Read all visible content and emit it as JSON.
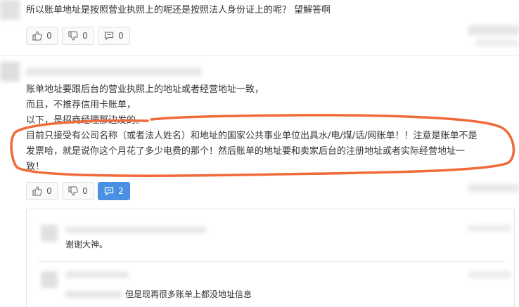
{
  "comment1": {
    "text": "所以账单地址是按照营业执照上的呢还是按照法人身份证上的呢？ 望解答啊",
    "likes": "0",
    "dislikes": "0",
    "replies": "0"
  },
  "comment2": {
    "lines": [
      "账单地址要跟后台的营业执照上的地址或者经营地址一致，",
      "而且，不推荐信用卡账单，",
      "以下，是招商经理那边发的。",
      "目前只接受有公司名称（或者法人姓名）和地址的国家公共事业单位出具水/电/煤/话/网账单！！注意是账单不是",
      "发票哈，就是说你这个月花了多少电费的那个！然后账单的地址要和卖家后台的注册地址或者实际经营地址一",
      "致！"
    ],
    "likes": "0",
    "dislikes": "0",
    "replies": "2"
  },
  "reply1": {
    "text": "谢谢大神。"
  },
  "reply2": {
    "text": "但是现再很多账单上都没地址信息"
  },
  "colors": {
    "accent": "#4a90e2",
    "annotation": "#f06a3a",
    "text": "#333333"
  },
  "icons": [
    "thumbs-up-icon",
    "thumbs-down-icon",
    "comment-icon"
  ]
}
